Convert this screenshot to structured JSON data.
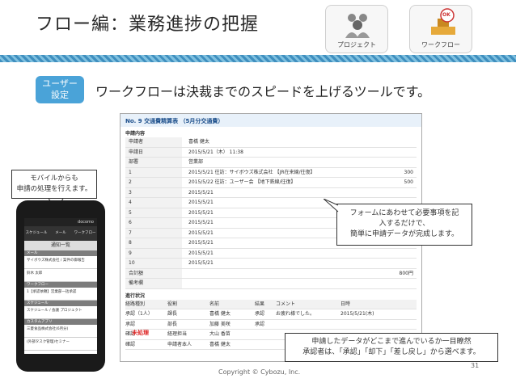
{
  "header": {
    "title": "フロー編：業務進捗の把握",
    "icon1_label": "プロジェクト",
    "icon2_label": "ワークフロー",
    "ok_stamp": "OK"
  },
  "badge": {
    "line1": "ユーザー",
    "line2": "設定"
  },
  "tagline": "ワークフローは決裁までのスピードを上げるツールです。",
  "mobile": {
    "callout_line1": "モバイルからも",
    "callout_line2": "申請の処理を行えます。",
    "carrier": "docomo",
    "tabs": [
      "スケジュール",
      "メール",
      "ワークフロー"
    ],
    "header": "通知一覧",
    "sections": [
      "メール",
      "ワークフロー",
      "スケジュール",
      "カスタムアプリ"
    ],
    "rows": [
      "サイボウズ株式会社 / 案件の御報告",
      "鈴木 太郎",
      "1【承認依頼】営業部一括承認",
      "スケジュール / 会議 プロジェクト",
      "三菱食品株式会社(6月分)",
      "(外部タスク管理)セミナー"
    ]
  },
  "form": {
    "title": "No. 9 交通費精算表 （5月分交通費）",
    "section1": "申請内容",
    "rows": [
      {
        "k": "申請者",
        "v": "喜橋 健太",
        "a": ""
      },
      {
        "k": "申請日",
        "v": "2015/5/21（木） 11:38",
        "a": ""
      },
      {
        "k": "部署",
        "v": "営業部",
        "a": ""
      },
      {
        "k": "1",
        "v": "2015/5/21 往訪：サイボウズ株式会社 【JR在来線/往復】",
        "a": "300"
      },
      {
        "k": "2",
        "v": "2015/5/22 往訪：ユーザー会 【地下鉄線/往復】",
        "a": "500"
      },
      {
        "k": "3",
        "v": "2015/5/21",
        "a": ""
      },
      {
        "k": "4",
        "v": "2015/5/21",
        "a": ""
      },
      {
        "k": "5",
        "v": "2015/5/21",
        "a": ""
      },
      {
        "k": "6",
        "v": "2015/5/21",
        "a": ""
      },
      {
        "k": "7",
        "v": "2015/5/21",
        "a": ""
      },
      {
        "k": "8",
        "v": "2015/5/21",
        "a": ""
      },
      {
        "k": "9",
        "v": "2015/5/21",
        "a": ""
      },
      {
        "k": "10",
        "v": "2015/5/21",
        "a": ""
      },
      {
        "k": "合計額",
        "v": "",
        "a": "800円"
      },
      {
        "k": "備考欄",
        "v": "",
        "a": ""
      }
    ],
    "section2": "進行状況",
    "progress_headers": [
      "経路種別",
      "役割",
      "名前",
      "結果",
      "コメント",
      "日時"
    ],
    "progress_rows": [
      [
        "承認（1人）",
        "課長",
        "喜橋 健太",
        "承認",
        "お疲れ様でした。",
        "2015/5/21(木)"
      ],
      [
        "承認",
        "部長",
        "加藤 美咲",
        "承認",
        "",
        ""
      ],
      [
        "確認",
        "経理担当",
        "大山 香苗",
        "",
        "",
        ""
      ],
      [
        "確認",
        "申請者本人",
        "喜橋 健太",
        "",
        "",
        ""
      ]
    ],
    "stamp": "未処理"
  },
  "callout1": {
    "line1": "フォームにあわせて必要事項を記",
    "line2": "入するだけで、",
    "line3": "簡単に申請データが完成します。"
  },
  "callout2": {
    "line1": "申請したデータがどこまで進んでいるか一目瞭然",
    "line2": "承認者は、「承認」「却下」「差し戻し」から選べます。"
  },
  "footer": {
    "copyright": "Copyright © Cybozu, Inc.",
    "page": "31"
  }
}
